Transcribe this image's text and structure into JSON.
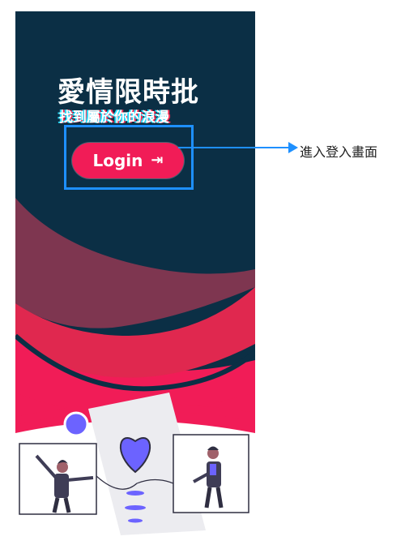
{
  "app": {
    "title": "愛情限時批",
    "subtitle": "找到屬於你的浪漫",
    "login_label": "Login",
    "login_icon": "login-arrow-icon"
  },
  "annotation": {
    "text": "進入登入畫面"
  },
  "colors": {
    "navy": "#0b2f45",
    "accent": "#f11c57",
    "mauve": "#7e3650",
    "purple": "#6c63ff",
    "highlight": "#1e90ff"
  }
}
